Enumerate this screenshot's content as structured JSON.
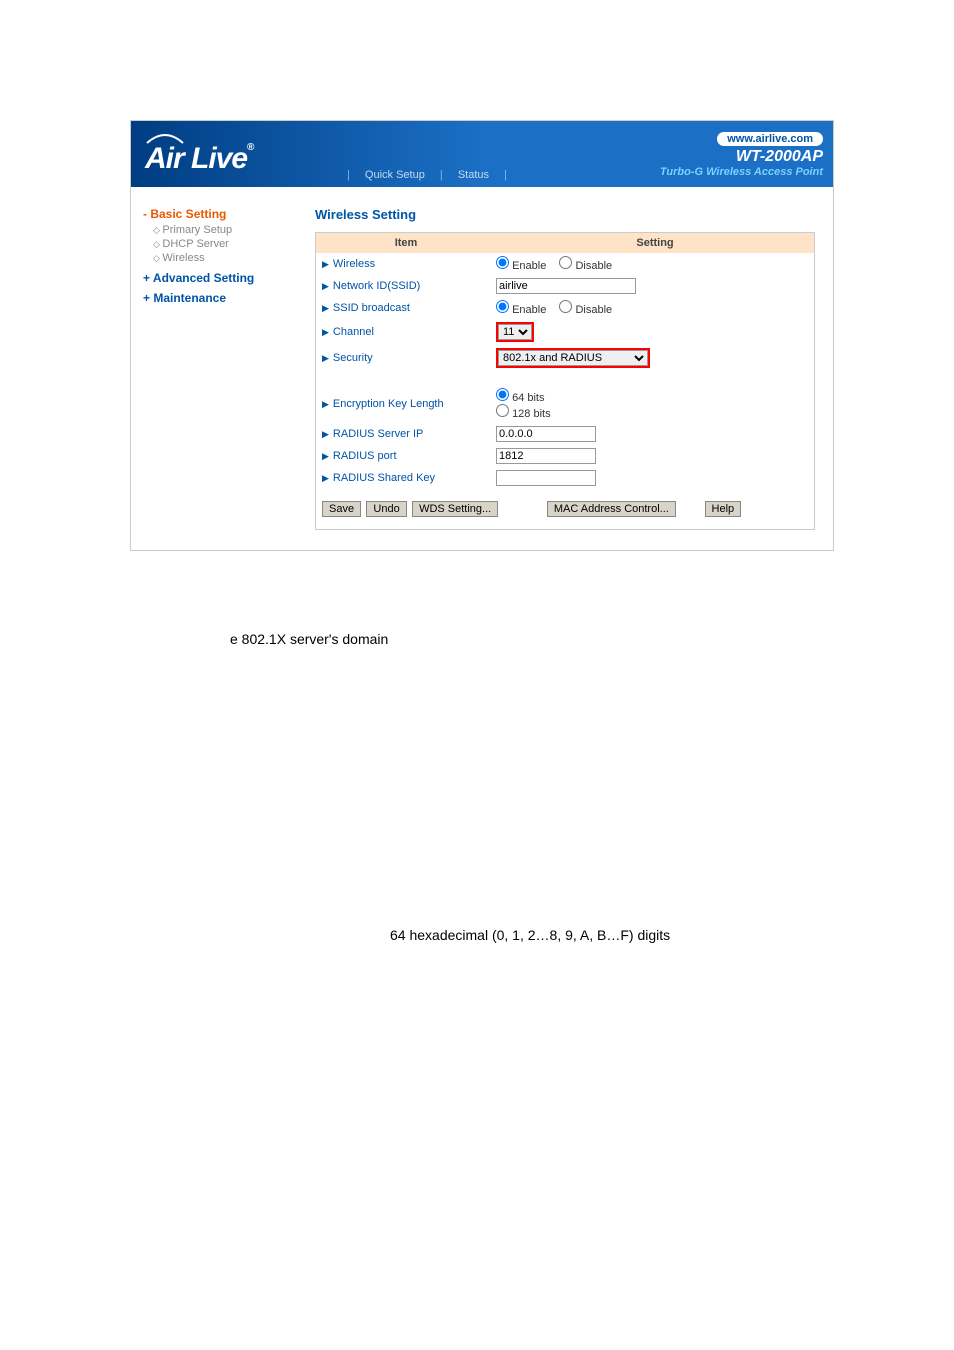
{
  "header": {
    "logo_text": "Air Live",
    "reg": "®",
    "url": "www.airlive.com",
    "model": "WT-2000AP",
    "tagline": "Turbo-G Wireless Access Point",
    "nav": {
      "quick_setup": "Quick Setup",
      "status": "Status"
    }
  },
  "sidebar": {
    "basic_title": "- Basic Setting",
    "items": [
      "Primary Setup",
      "DHCP Server",
      "Wireless"
    ],
    "advanced": "+ Advanced Setting",
    "maintenance": "+ Maintenance"
  },
  "main": {
    "title": "Wireless Setting",
    "th_item": "Item",
    "th_setting": "Setting",
    "rows": {
      "wireless": {
        "label": "Wireless",
        "enable": "Enable",
        "disable": "Disable"
      },
      "ssid": {
        "label": "Network ID(SSID)",
        "value": "airlive"
      },
      "broadcast": {
        "label": "SSID broadcast",
        "enable": "Enable",
        "disable": "Disable"
      },
      "channel": {
        "label": "Channel",
        "value": "11"
      },
      "security": {
        "label": "Security",
        "value": "802.1x and RADIUS"
      },
      "keylen": {
        "label": "Encryption Key Length",
        "opt64": "64 bits",
        "opt128": "128 bits"
      },
      "radius_ip": {
        "label": "RADIUS Server IP",
        "value": "0.0.0.0"
      },
      "radius_port": {
        "label": "RADIUS port",
        "value": "1812"
      },
      "radius_key": {
        "label": "RADIUS Shared Key",
        "value": ""
      }
    },
    "buttons": {
      "save": "Save",
      "undo": "Undo",
      "wds": "WDS Setting...",
      "mac": "MAC Address Control...",
      "help": "Help"
    }
  },
  "extra": {
    "line1": "e 802.1X server's domain",
    "line2": "64 hexadecimal (0, 1, 2…8, 9, A, B…F) digits"
  }
}
